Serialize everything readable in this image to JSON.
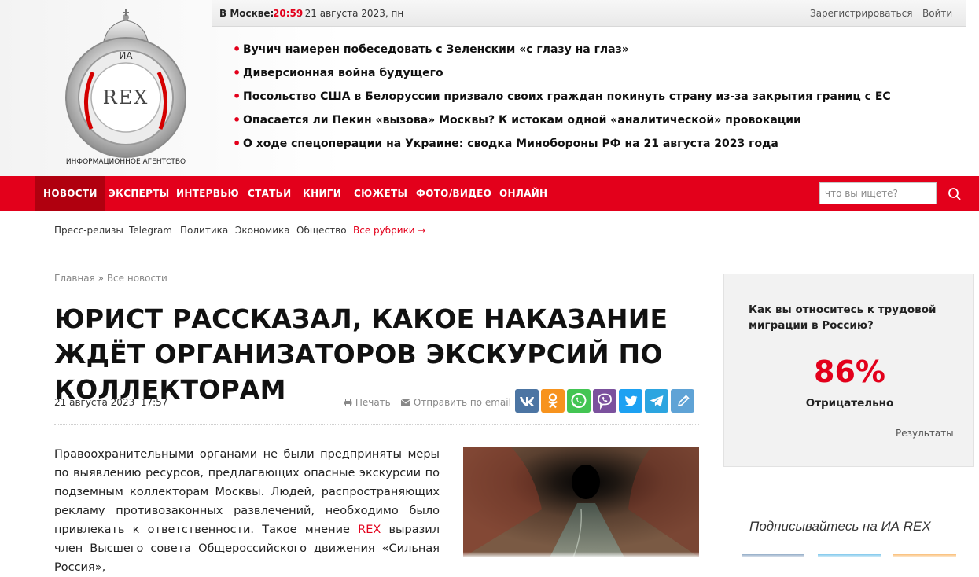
{
  "topbar": {
    "city": "В Москве:",
    "time": "20:59",
    "date": ", 21 августа 2023, пн",
    "register": "Зарегистрироваться",
    "login": "Войти"
  },
  "logo": {
    "text_ia": "ИА",
    "text_rex": "REX",
    "caption": "ИНФОРМАЦИОННОЕ АГЕНТСТВО"
  },
  "headlines": [
    "Вучич намерен побеседовать с Зеленским «с глазу на глаз»",
    "Диверсионная война будущего",
    "Посольство США в Белоруссии призвало своих граждан покинуть страну из-за закрытия границ с ЕС",
    "Опасается ли Пекин «вызова» Москвы? К истокам одной «аналитической» провокации",
    "О ходе спецоперации на Украине: сводка Минобороны РФ на 21 августа 2023 года"
  ],
  "nav": {
    "items": [
      "НОВОСТИ",
      "ЭКСПЕРТЫ",
      "ИНТЕРВЬЮ",
      "СТАТЬИ",
      "КНИГИ",
      "СЮЖЕТЫ",
      "ФОТО/ВИДЕО",
      "ОНЛАЙН"
    ],
    "search_placeholder": "что вы ищете?"
  },
  "subnav": {
    "items": [
      "Пресс-релизы",
      "Telegram",
      "Политика",
      "Экономика",
      "Общество"
    ],
    "all": "Все рубрики →"
  },
  "breadcrumb": {
    "home": "Главная",
    "sep": " » ",
    "all_news": "Все новости"
  },
  "article": {
    "title": "ЮРИСТ РАССКАЗАЛ, КАКОЕ НАКАЗАНИЕ ЖДЁТ ОРГАНИЗАТОРОВ ЭКСКУРСИЙ ПО КОЛЛЕКТОРАМ",
    "datetime": "21 августа 2023  17:57",
    "print": "Печать",
    "email": "Отправить по email",
    "text_before": "Правоохранительными органами не были предприняты меры по выявлению ресурсов, предлагающих опасные экскурсии по подземным коллекторам Москвы. Людей, распространяющих рекламу противозаконных развлечений, необходимо было привлекать к ответственности. Такое мнение ",
    "text_link": "REX",
    "text_after": " выразил член Высшего совета Общероссийского движения «Сильная Россия»,"
  },
  "share": {
    "colors": {
      "vk": "#4c75a3",
      "ok": "#f7931e",
      "whatsapp": "#43c553",
      "viber": "#7b519d",
      "twitter": "#1da1f2",
      "telegram": "#2ca5e0",
      "livejournal": "#5fa3d6"
    }
  },
  "poll": {
    "question": "Как вы относитесь к трудовой миграции в Россию?",
    "percent": "86%",
    "answer": "Отрицательно",
    "results": "Результаты"
  },
  "sidebar": {
    "subscribe": "Подписывайтесь на ИА REX"
  },
  "colors": {
    "brand_red": "#e3001b",
    "nav_active": "#b0000f"
  }
}
